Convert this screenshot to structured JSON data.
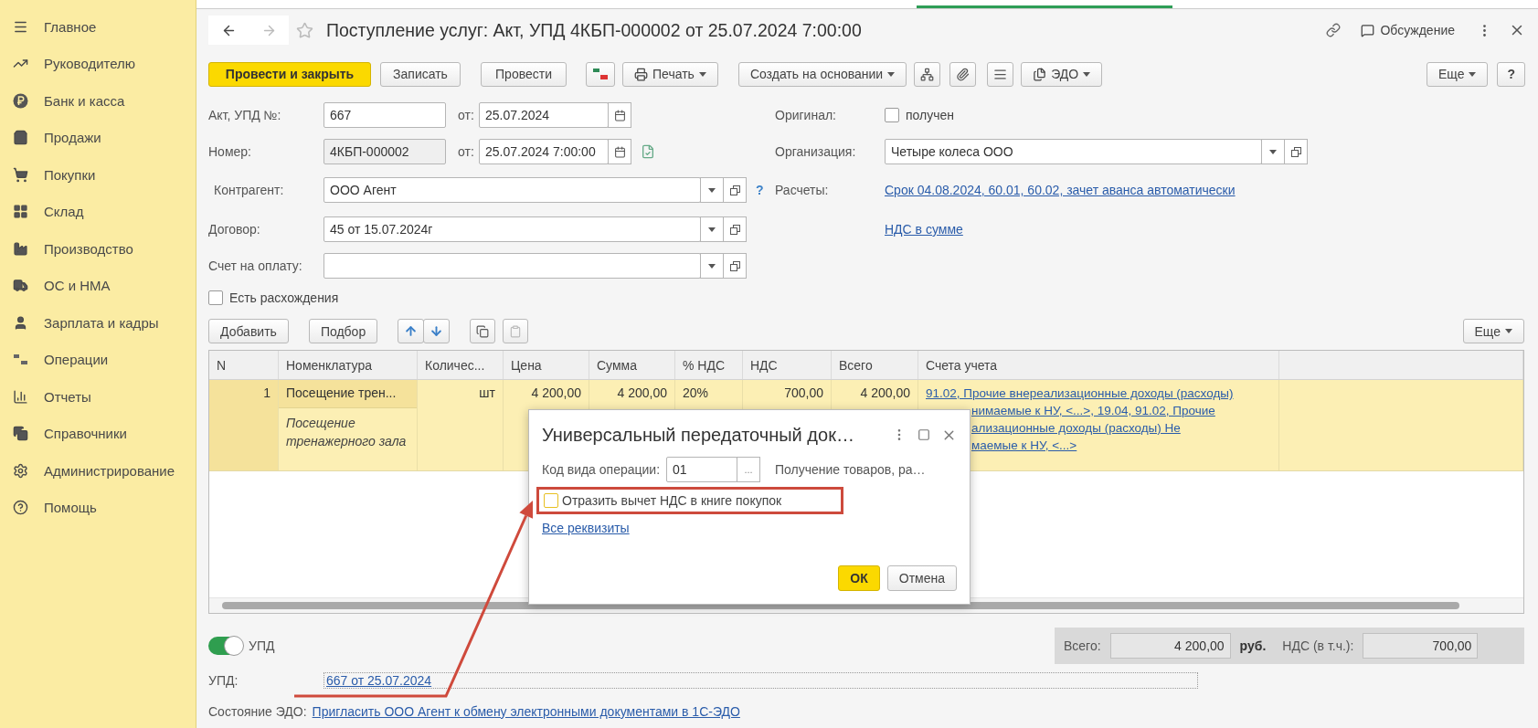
{
  "sidebar": {
    "items": [
      {
        "label": "Главное"
      },
      {
        "label": "Руководителю"
      },
      {
        "label": "Банк и касса"
      },
      {
        "label": "Продажи"
      },
      {
        "label": "Покупки"
      },
      {
        "label": "Склад"
      },
      {
        "label": "Производство"
      },
      {
        "label": "ОС и НМА"
      },
      {
        "label": "Зарплата и кадры"
      },
      {
        "label": "Операции"
      },
      {
        "label": "Отчеты"
      },
      {
        "label": "Справочники"
      },
      {
        "label": "Администрирование"
      },
      {
        "label": "Помощь"
      }
    ]
  },
  "window": {
    "title": "Поступление услуг: Акт, УПД 4КБП-000002 от 25.07.2024 7:00:00",
    "discussion": "Обсуждение"
  },
  "toolbar": {
    "post_close": "Провести и закрыть",
    "save": "Записать",
    "post": "Провести",
    "print": "Печать",
    "create_based": "Создать на основании",
    "edo": "ЭДО",
    "more": "Еще",
    "help": "?"
  },
  "form": {
    "act_number": {
      "label": "Акт, УПД №:",
      "value": "667",
      "date_label": "от:",
      "date": "25.07.2024"
    },
    "number": {
      "label": "Номер:",
      "value": "4КБП-000002",
      "date_label": "от:",
      "date": "25.07.2024  7:00:00"
    },
    "counterparty": {
      "label": "Контрагент:",
      "value": "ООО Агент",
      "help": "?"
    },
    "contract": {
      "label": "Договор:",
      "value": "45 от 15.07.2024г"
    },
    "invoice": {
      "label": "Счет на оплату:"
    },
    "discrepancies": {
      "label": "Есть расхождения",
      "checked": false
    },
    "original": {
      "label": "Оригинал:",
      "checkbox_label": "получен",
      "checked": false
    },
    "organization": {
      "label": "Организация:",
      "value": "Четыре колеса ООО"
    },
    "settlements": {
      "label": "Расчеты:",
      "link": "Срок 04.08.2024, 60.01, 60.02, зачет аванса автоматически"
    },
    "vat_link": "НДС в сумме"
  },
  "table_toolbar": {
    "add": "Добавить",
    "pick": "Подбор",
    "more": "Еще"
  },
  "table": {
    "columns": [
      "N",
      "Номенклатура",
      "Количес...",
      "Цена",
      "Сумма",
      "% НДС",
      "НДС",
      "Всего",
      "Счета учета"
    ],
    "rows": [
      {
        "n": "1",
        "item": "Посещение трен...",
        "item_content": "Посещение тренажерного зала",
        "unit": "шт",
        "price": "4 200,00",
        "sum": "4 200,00",
        "vat_rate": "20%",
        "vat": "700,00",
        "total": "4 200,00",
        "selected": true,
        "accounts": [
          "91.02, Прочие внереализационные доходы (расходы)",
          "нимаемые к НУ, <...>, 19.04, 91.02, Прочие",
          "ализационные доходы (расходы) Не",
          "маемые к НУ, <...>"
        ]
      }
    ]
  },
  "footer": {
    "upd_toggle": {
      "label": "УПД",
      "on": true
    },
    "totals": {
      "total_label": "Всего:",
      "total": "4 200,00",
      "currency": "руб.",
      "vat_label": "НДС (в т.ч.):",
      "vat": "700,00"
    },
    "upd": {
      "label": "УПД:",
      "link": "667 от 25.07.2024"
    },
    "edo": {
      "label": "Состояние ЭДО:",
      "link": "Пригласить ООО Агент к обмену электронными документами в 1С-ЭДО"
    }
  },
  "dialog": {
    "title": "Универсальный передаточный док…",
    "op_code": {
      "label": "Код вида операции:",
      "value": "01",
      "select": "...",
      "description": "Получение товаров, ра…"
    },
    "vat_deduction": {
      "label": "Отразить вычет НДС в книге покупок",
      "checked": false
    },
    "all_details": "Все реквизиты",
    "ok": "ОК",
    "cancel": "Отмена"
  }
}
